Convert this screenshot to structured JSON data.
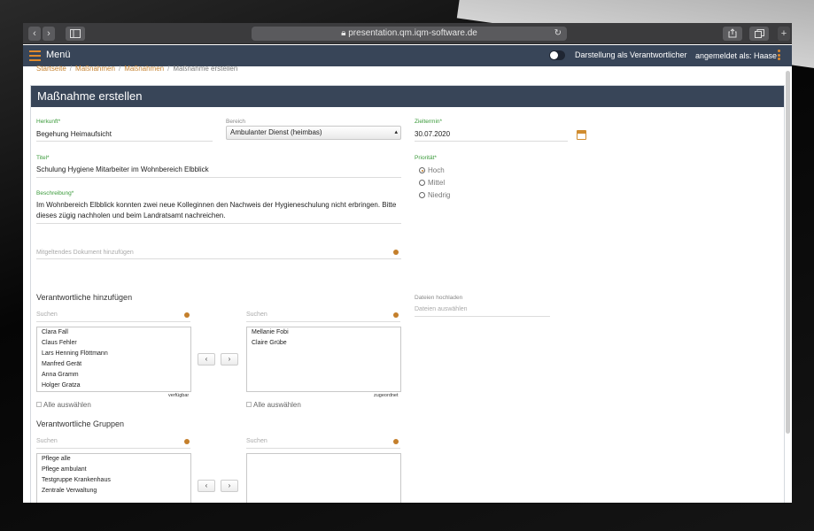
{
  "browser": {
    "url": "presentation.qm.iqm-software.de",
    "back_icon": "‹",
    "forward_icon": "›",
    "reload_icon": "↻",
    "new_tab_icon": "+"
  },
  "header": {
    "menu_label": "Menü",
    "toggle_label": "Darstellung als Verantwortlicher",
    "user_label": "angemeldet als: Haase"
  },
  "breadcrumb": [
    "Startseite",
    "Maßnahmen",
    "Maßnahmen",
    "Maßnahme erstellen"
  ],
  "form": {
    "title": "Maßnahme erstellen",
    "herkunft_label": "Herkunft*",
    "herkunft_value": "Begehung Heimaufsicht",
    "bereich_label": "Bereich",
    "bereich_value": "Ambulanter Dienst (heimbas)",
    "zieltermin_label": "Zieltermin*",
    "zieltermin_value": "30.07.2020",
    "titel_label": "Titel*",
    "titel_value": "Schulung Hygiene Mitarbeiter im Wohnbereich Elbblick",
    "prioritaet_label": "Priorität*",
    "prioritaet_options": [
      "Hoch",
      "Mittel",
      "Niedrig"
    ],
    "prioritaet_selected": "Hoch",
    "beschreibung_label": "Beschreibung*",
    "beschreibung_line1": "Im Wohnbereich Elbblick konnten zwei neue Kolleginnen den Nachweis der Hygieneschulung nicht erbringen. Bitte",
    "beschreibung_line2": "dieses zügig nachholen und beim  Landratsamt nachreichen.",
    "dokument_placeholder": "Mitgeltendes Dokument hinzufügen",
    "dateien_label": "Dateien hochladen",
    "dateien_placeholder": "Dateien auswählen"
  },
  "verantwortliche": {
    "heading": "Verantwortliche hinzufügen",
    "search_placeholder": "Suchen",
    "available": [
      "Clara Fall",
      "Claus Fehler",
      "Lars Henning Flöttmann",
      "Manfred Gerät",
      "Anna Gramm",
      "Holger Gratza"
    ],
    "available_caption": "verfügbar",
    "assigned": [
      "Mellanie Fobi",
      "Claire Grübe"
    ],
    "assigned_caption": "zugeordnet",
    "select_all": "Alle auswählen",
    "move_left": "‹",
    "move_right": "›"
  },
  "gruppen": {
    "heading": "Verantwortliche Gruppen",
    "search_placeholder": "Suchen",
    "available": [
      "Pflege alle",
      "Pflege ambulant",
      "Testgruppe Krankenhaus",
      "Zentrale Verwaltung"
    ],
    "assigned": [],
    "move_left": "‹",
    "move_right": "›"
  },
  "colors": {
    "header_bg": "#384558",
    "accent": "#e08a2c",
    "label_green": "#3a9a3a"
  }
}
